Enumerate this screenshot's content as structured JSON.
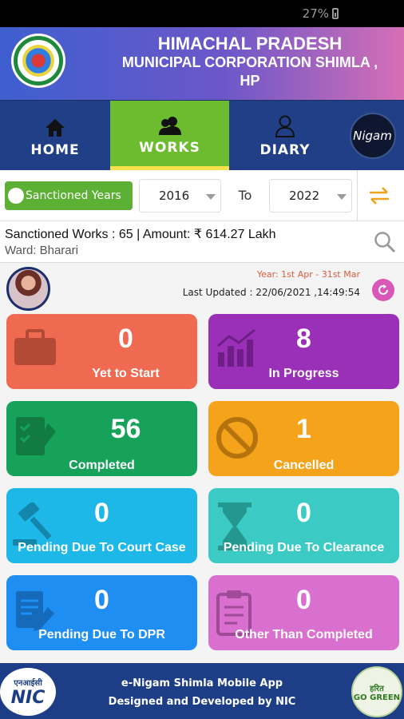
{
  "status": {
    "battery": "27%"
  },
  "header": {
    "title_line1": "HIMACHAL PRADESH",
    "title_line2": "MUNICIPAL CORPORATION SHIMLA ,",
    "title_line3": "HP"
  },
  "tabs": [
    {
      "label": "HOME",
      "icon": "home-icon"
    },
    {
      "label": "WORKS",
      "icon": "users-icon",
      "active": true
    },
    {
      "label": "DIARY",
      "icon": "person-icon"
    }
  ],
  "enigam_label": "Nigam",
  "filter": {
    "toggle_label": "Sanctioned Years",
    "from_year": "2016",
    "to_label": "To",
    "to_year": "2022"
  },
  "summary": {
    "line1": "Sanctioned Works : 65 | Amount: ₹ 614.27 Lakh",
    "line2": "Ward: Bharari"
  },
  "info": {
    "year_range": "Year: 1st Apr - 31st Mar",
    "last_updated": "Last Updated : 22/06/2021 ,14:49:54"
  },
  "cards": [
    {
      "count": "0",
      "label": "Yet to Start",
      "color": "#ef6a51",
      "icon": "briefcase-icon"
    },
    {
      "count": "8",
      "label": "In Progress",
      "color": "#9a2fb8",
      "icon": "chart-icon"
    },
    {
      "count": "56",
      "label": "Completed",
      "color": "#17a259",
      "icon": "checklist-icon"
    },
    {
      "count": "1",
      "label": "Cancelled",
      "color": "#f4a31a",
      "icon": "ban-icon"
    },
    {
      "count": "0",
      "label": "Pending Due To Court Case",
      "color": "#1db8e8",
      "icon": "gavel-icon"
    },
    {
      "count": "0",
      "label": "Pending Due To Clearance",
      "color": "#3ccbc4",
      "icon": "hourglass-icon"
    },
    {
      "count": "0",
      "label": "Pending Due To DPR",
      "color": "#1e8ef2",
      "icon": "document-icon"
    },
    {
      "count": "0",
      "label": "Other Than Completed",
      "color": "#d96fcf",
      "icon": "clipboard-icon"
    }
  ],
  "footer": {
    "line1": "e-Nigam Shimla Mobile App",
    "line2": "Designed and Developed by NIC",
    "nic_hindi": "एनआईसी",
    "nic_label": "NIC",
    "green_hindi": "हरित",
    "green_label": "GO GREEN"
  }
}
